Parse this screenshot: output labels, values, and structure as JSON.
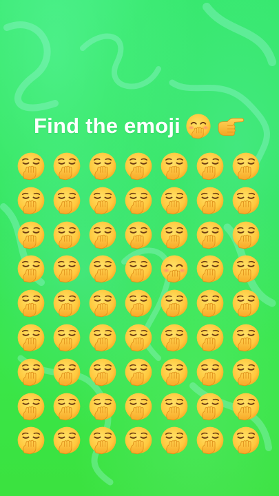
{
  "title": {
    "text": "Find the emoji",
    "target_icon": "smiling-face-with-hand-over-mouth-icon",
    "pointer_icon": "backhand-index-pointing-right-icon"
  },
  "grid": {
    "rows": 9,
    "columns": 7,
    "default_icon": "yawning-face-icon",
    "odd_one": {
      "row": 4,
      "column": 5,
      "icon": "smiling-face-with-hand-over-mouth-icon"
    }
  },
  "colors": {
    "background_top": "#35e86a",
    "background_bottom": "#3be23f",
    "title_text": "#ffffff",
    "emoji_face": "#ffc83d",
    "emoji_face_shadow": "#f5a623",
    "hand": "#ffb938",
    "mouth": "#6b2b19"
  }
}
